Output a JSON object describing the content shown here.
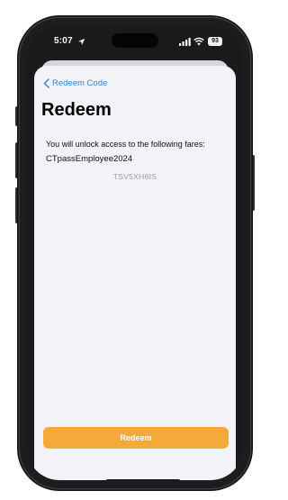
{
  "status_bar": {
    "time": "5:07",
    "battery": "93"
  },
  "nav": {
    "back_label": "Redeem Code"
  },
  "page": {
    "title": "Redeem",
    "intro": "You will unlock access to the following fares:",
    "fare": "CTpassEmployee2024",
    "code": "TSV5XH6IS"
  },
  "actions": {
    "redeem_label": "Redeem"
  },
  "colors": {
    "accent": "#f5a93a",
    "link": "#3b82c4",
    "background": "#f2f2f7"
  },
  "icons": [
    "location-arrow-icon",
    "signal-icon",
    "wifi-icon",
    "battery-icon",
    "chevron-left-icon"
  ]
}
